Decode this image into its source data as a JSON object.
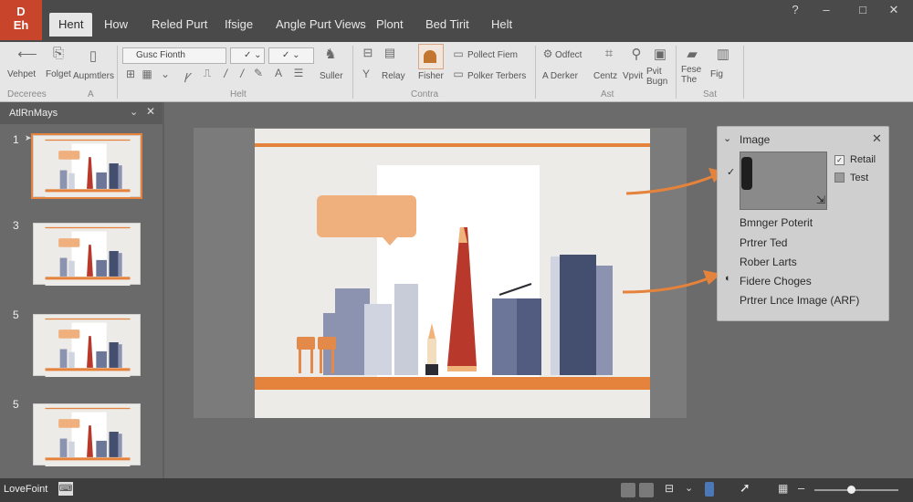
{
  "app": {
    "badge_line1": "D",
    "badge_line2": "Eh"
  },
  "tabs": [
    "Hent",
    "How",
    "Reled Purt",
    "Ifsige",
    "Angle Purt Views",
    "Plont",
    "Bed Tirit",
    "Helt"
  ],
  "window_controls": [
    "?",
    "–",
    "□",
    "✕"
  ],
  "ribbon": {
    "groups": {
      "g1": "Decerees",
      "g2": "A",
      "g3": "Helt",
      "g4": "Contra",
      "g5": "Ast",
      "g6": "Sat"
    },
    "buttons": {
      "vehpet": "Vehpet",
      "folget": "Folget",
      "aupmtlers": "Aupmtlers",
      "font_combo": "Gusc Fionth",
      "suller": "Suller",
      "relay": "Relay",
      "fisher": "Fisher",
      "pollect_fiem": "Pollect Fiem",
      "polker_terbers": "Polker Terbers",
      "odfect": "Odfect",
      "aderker": "A Derker",
      "centz": "Centz",
      "vpvit": "Vpvit",
      "pvit_bugn": "Pvit Bugn",
      "fese_the": "Fese The",
      "fig": "Fig"
    }
  },
  "pane": {
    "title": "AtlRnMays",
    "slides": [
      "1",
      "3",
      "5",
      "5"
    ]
  },
  "panel": {
    "title": "Image",
    "opt_retail": "Retail",
    "opt_test": "Test",
    "items": [
      "Bmnger Poterit",
      "Prtrer Ted",
      "Rober Larts",
      "Fidere Choges",
      "Prtrer Lnce Image (ARF)"
    ]
  },
  "status": {
    "label": "LoveFoint"
  },
  "colors": {
    "accent": "#e5823c",
    "brand": "#c8452c",
    "slide_red": "#b8392b",
    "slide_navy": "#444e6e",
    "slide_slate": "#8b93b0"
  }
}
